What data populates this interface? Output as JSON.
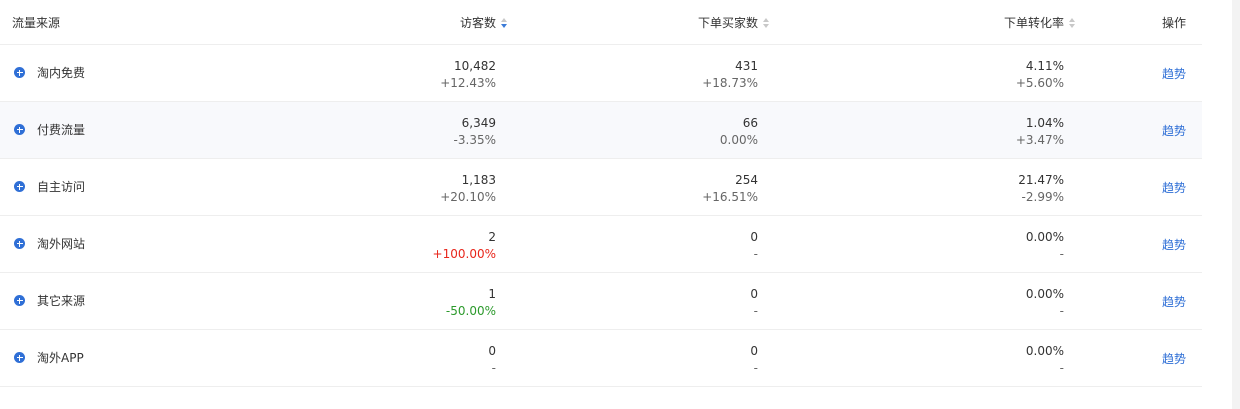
{
  "header": {
    "source": "流量来源",
    "visitors": "访客数",
    "buyers": "下单买家数",
    "conversion": "下单转化率",
    "operation": "操作"
  },
  "sort": {
    "visitors": "descending",
    "buyers": "none",
    "conversion": "none"
  },
  "colors": {
    "accent": "#2f6fd6",
    "increase_highlight": "#e8261b",
    "decrease_highlight": "#2c9a2c"
  },
  "rows": [
    {
      "source": "淘内免费",
      "visitors": "10,482",
      "visitors_change": "+12.43%",
      "buyers": "431",
      "buyers_change": "+18.73%",
      "conversion": "4.11%",
      "conversion_change": "+5.60%",
      "action": "趋势"
    },
    {
      "source": "付费流量",
      "visitors": "6,349",
      "visitors_change": "-3.35%",
      "buyers": "66",
      "buyers_change": "0.00%",
      "conversion": "1.04%",
      "conversion_change": "+3.47%",
      "action": "趋势"
    },
    {
      "source": "自主访问",
      "visitors": "1,183",
      "visitors_change": "+20.10%",
      "buyers": "254",
      "buyers_change": "+16.51%",
      "conversion": "21.47%",
      "conversion_change": "-2.99%",
      "action": "趋势"
    },
    {
      "source": "淘外网站",
      "visitors": "2",
      "visitors_change": "+100.00%",
      "buyers": "0",
      "buyers_change": "-",
      "conversion": "0.00%",
      "conversion_change": "-",
      "action": "趋势"
    },
    {
      "source": "其它来源",
      "visitors": "1",
      "visitors_change": "-50.00%",
      "buyers": "0",
      "buyers_change": "-",
      "conversion": "0.00%",
      "conversion_change": "-",
      "action": "趋势"
    },
    {
      "source": "淘外APP",
      "visitors": "0",
      "visitors_change": "-",
      "buyers": "0",
      "buyers_change": "-",
      "conversion": "0.00%",
      "conversion_change": "-",
      "action": "趋势"
    }
  ]
}
